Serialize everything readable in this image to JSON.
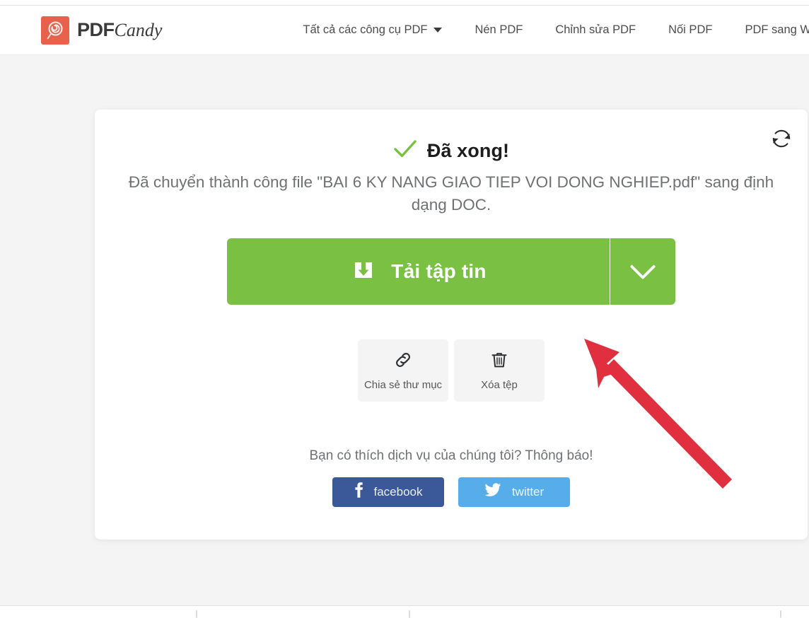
{
  "brand": {
    "name_bold": "PDF",
    "name_script": "Candy",
    "logo_icon": "lollipop-icon",
    "logo_color": "#e8614d"
  },
  "header": {
    "nav": [
      {
        "label": "Tất cả các công cụ PDF",
        "has_caret": true
      },
      {
        "label": "Nén PDF",
        "has_caret": false
      },
      {
        "label": "Chỉnh sửa PDF",
        "has_caret": false
      },
      {
        "label": "Nối PDF",
        "has_caret": false
      },
      {
        "label": "PDF sang W",
        "has_caret": false
      }
    ]
  },
  "card": {
    "reset_icon": "refresh-icon",
    "check_icon": "check-icon",
    "title": "Đã xong!",
    "description": "Đã chuyển thành công file \"BAI 6 KY NANG GIAO TIEP VOI DONG NGHIEP.pdf\" sang định dạng DOC.",
    "download": {
      "icon": "download-tray-icon",
      "label": "Tải tập tin",
      "dropdown_icon": "chevron-down-icon",
      "color": "#7ac143"
    },
    "actions": [
      {
        "icon": "link-icon",
        "label": "Chia sẻ thư mục"
      },
      {
        "icon": "trash-icon",
        "label": "Xóa tệp"
      }
    ],
    "social": {
      "prompt": "Bạn có thích dịch vụ của chúng tôi? Thông báo!",
      "buttons": [
        {
          "icon": "facebook-icon",
          "label": "facebook",
          "color": "#3b5998"
        },
        {
          "icon": "twitter-icon",
          "label": "twitter",
          "color": "#56ade9"
        }
      ]
    }
  },
  "annotation": {
    "type": "arrow",
    "color": "#e03040",
    "points_to": "download-button-dropdown-area"
  }
}
